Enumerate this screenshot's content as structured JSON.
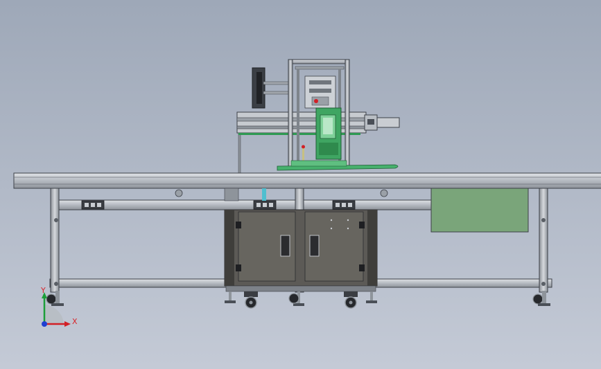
{
  "triad": {
    "y_label": "Y",
    "x_label": "X",
    "colors": {
      "x": "#d21f26",
      "y": "#1d9e3a",
      "z": "#1f3fd2"
    }
  },
  "colors": {
    "background_top": "#9ea8b8",
    "background_bottom": "#c4cad6",
    "frame": "#b7bcc4",
    "frame_edge": "#4a4f57",
    "cabinet": "#5c5a56",
    "panel_green": "#7aa57a",
    "accent_green": "#2f9a52"
  }
}
